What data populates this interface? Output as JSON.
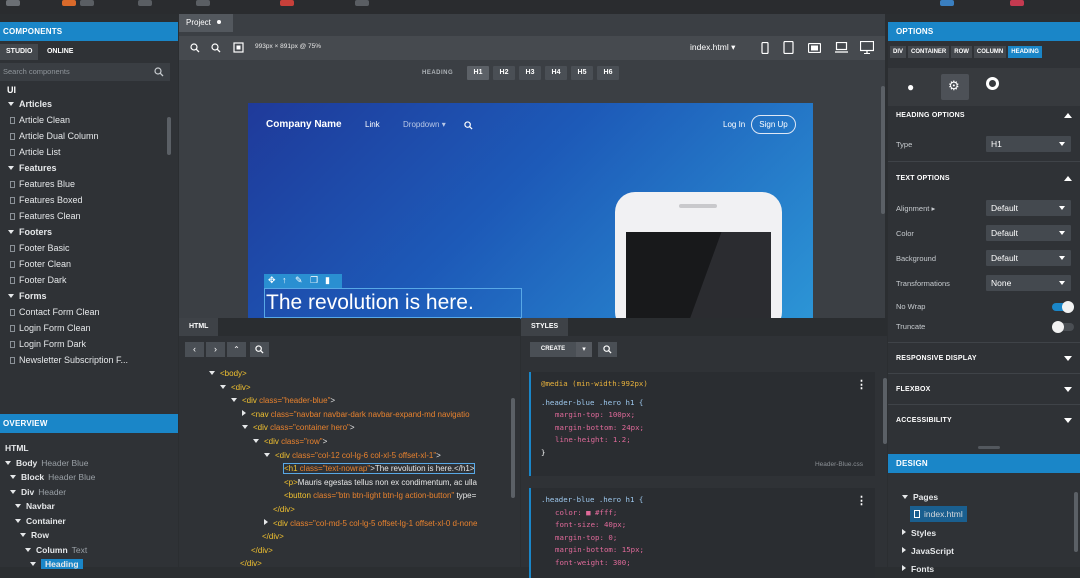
{
  "left_panel": {
    "components_title": "COMPONENTS",
    "tabs": [
      "STUDIO",
      "ONLINE"
    ],
    "search_placeholder": "Search components",
    "root": "UI",
    "tree": [
      {
        "label": "Articles",
        "type": "cat"
      },
      {
        "label": "Article Clean",
        "type": "item"
      },
      {
        "label": "Article Dual Column",
        "type": "item"
      },
      {
        "label": "Article List",
        "type": "item"
      },
      {
        "label": "Features",
        "type": "cat"
      },
      {
        "label": "Features Blue",
        "type": "item"
      },
      {
        "label": "Features Boxed",
        "type": "item"
      },
      {
        "label": "Features Clean",
        "type": "item"
      },
      {
        "label": "Footers",
        "type": "cat"
      },
      {
        "label": "Footer Basic",
        "type": "item"
      },
      {
        "label": "Footer Clean",
        "type": "item"
      },
      {
        "label": "Footer Dark",
        "type": "item"
      },
      {
        "label": "Forms",
        "type": "cat"
      },
      {
        "label": "Contact Form Clean",
        "type": "item"
      },
      {
        "label": "Login Form Clean",
        "type": "item"
      },
      {
        "label": "Login Form Dark",
        "type": "item"
      },
      {
        "label": "Newsletter Subscription F...",
        "type": "item"
      }
    ],
    "overview_title": "OVERVIEW",
    "overview": [
      {
        "label": "HTML",
        "sub": ""
      },
      {
        "label": "Body",
        "sub": "Header Blue"
      },
      {
        "label": "Block",
        "sub": "Header Blue"
      },
      {
        "label": "Div",
        "sub": "Header"
      },
      {
        "label": "Navbar",
        "sub": ""
      },
      {
        "label": "Container",
        "sub": ""
      },
      {
        "label": "Row",
        "sub": ""
      },
      {
        "label": "Column",
        "sub": "Text"
      },
      {
        "label": "Heading",
        "sub": ""
      }
    ]
  },
  "canvas": {
    "tab_label": "Project",
    "size_label": "993px × 891px @ 75%",
    "file_selector": "index.html",
    "heading_label": "HEADING",
    "heading_buttons": [
      "H1",
      "H2",
      "H3",
      "H4",
      "H5",
      "H6"
    ],
    "preview": {
      "brand": "Company Name",
      "link": "Link",
      "dropdown": "Dropdown",
      "login": "Log In",
      "signup": "Sign Up",
      "headline": "The revolution is here."
    }
  },
  "html_panel": {
    "title": "HTML",
    "lines": [
      {
        "indent": 0,
        "tag": "<body>",
        "attr": "",
        "val": "",
        "rest": ""
      },
      {
        "indent": 1,
        "tag": "<div>",
        "attr": "",
        "val": "",
        "rest": ""
      },
      {
        "indent": 2,
        "tag": "<div",
        "attr": " class=",
        "val": "\"header-blue\"",
        "rest": ">"
      },
      {
        "indent": 3,
        "tag": "<nav",
        "attr": " class=",
        "val": "\"navbar navbar-dark navbar-expand-md navigatio",
        "rest": ""
      },
      {
        "indent": 3,
        "tag": "<div",
        "attr": " class=",
        "val": "\"container hero\"",
        "rest": ">"
      },
      {
        "indent": 4,
        "tag": "<div",
        "attr": " class=",
        "val": "\"row\"",
        "rest": ">"
      },
      {
        "indent": 5,
        "tag": "<div",
        "attr": " class=",
        "val": "\"col-12 col-lg-6 col-xl-5 offset-xl-1\"",
        "rest": ">"
      },
      {
        "indent": 6,
        "tag": "<h1",
        "attr": " class=",
        "val": "\"text-nowrap\"",
        "rest": ">The revolution is here.</h1>"
      },
      {
        "indent": 6,
        "tag": "<p>",
        "attr": "",
        "val": "",
        "rest": "Mauris egestas tellus non ex condimentum, ac ulla"
      },
      {
        "indent": 6,
        "tag": "<button",
        "attr": " class=",
        "val": "\"btn btn-light btn-lg action-button\"",
        "rest": " type="
      },
      {
        "indent": 5,
        "tag": "</div>",
        "attr": "",
        "val": "",
        "rest": ""
      },
      {
        "indent": 5,
        "tag": "<div",
        "attr": " class=",
        "val": "\"col-md-5 col-lg-5 offset-lg-1 offset-xl-0 d-none",
        "rest": ""
      },
      {
        "indent": 4,
        "tag": "</div>",
        "attr": "",
        "val": "",
        "rest": ""
      },
      {
        "indent": 3,
        "tag": "</div>",
        "attr": "",
        "val": "",
        "rest": ""
      },
      {
        "indent": 2,
        "tag": "</div>",
        "attr": "",
        "val": "",
        "rest": ""
      }
    ]
  },
  "styles_panel": {
    "title": "STYLES",
    "create_label": "CREATE",
    "block1": {
      "media": "@media (min-width:992px)",
      "selector": ".header-blue .hero h1 {",
      "props": [
        "margin-top: 100px;",
        "margin-bottom: 24px;",
        "line-height: 1.2;"
      ],
      "close": "}",
      "file": "Header-Blue.css"
    },
    "block2": {
      "selector": ".header-blue .hero h1 {",
      "props": [
        "color: ■ #fff;",
        "font-size: 40px;",
        "margin-top: 0;",
        "margin-bottom: 15px;",
        "font-weight: 300;"
      ]
    }
  },
  "right_panel": {
    "options_title": "OPTIONS",
    "breadcrumb": [
      "DIV",
      "CONTAINER",
      "ROW",
      "COLUMN",
      "HEADING"
    ],
    "heading_options_title": "HEADING OPTIONS",
    "type_label": "Type",
    "type_value": "H1",
    "text_options_title": "TEXT OPTIONS",
    "alignment_label": "Alignment",
    "alignment_value": "Default",
    "color_label": "Color",
    "color_value": "Default",
    "background_label": "Background",
    "background_value": "Default",
    "transformations_label": "Transformations",
    "transformations_value": "None",
    "nowrap_label": "No Wrap",
    "nowrap_on": true,
    "truncate_label": "Truncate",
    "truncate_on": false,
    "responsive_title": "RESPONSIVE DISPLAY",
    "flexbox_title": "FLEXBOX",
    "accessibility_title": "ACCESSIBILITY",
    "design_title": "DESIGN",
    "design_items": [
      "Pages",
      "index.html",
      "Styles",
      "JavaScript",
      "Fonts"
    ]
  },
  "colors": {
    "accent": "#1a86c8",
    "panel": "#2f3236",
    "toggle_on": "#1a86c8"
  }
}
